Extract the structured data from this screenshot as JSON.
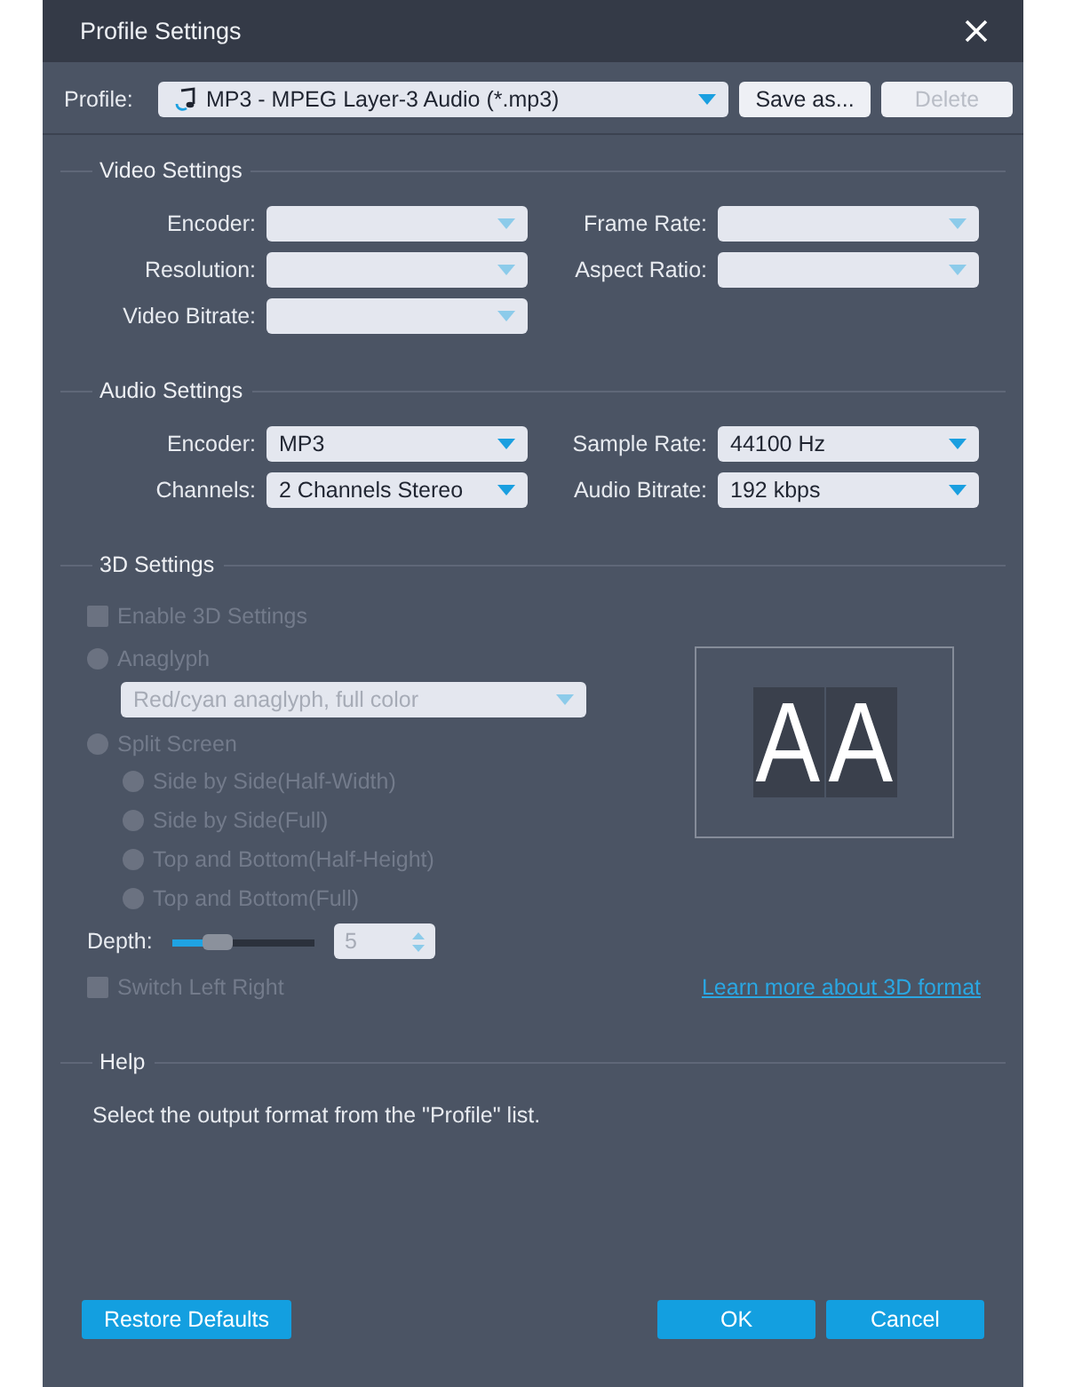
{
  "window": {
    "title": "Profile Settings"
  },
  "profile": {
    "label": "Profile:",
    "value": "MP3 - MPEG Layer-3 Audio (*.mp3)",
    "buttons": [
      {
        "label": "Save as...",
        "disabled": false
      },
      {
        "label": "Delete",
        "disabled": true
      }
    ]
  },
  "video_settings": {
    "title": "Video Settings",
    "fields": [
      {
        "label": "Encoder:",
        "disabled": true
      },
      {
        "label": "Frame Rate:",
        "disabled": true
      },
      {
        "label": "Resolution:",
        "disabled": true
      },
      {
        "label": "Aspect Ratio:",
        "disabled": true
      },
      {
        "label": "Video Bitrate:",
        "disabled": true
      }
    ]
  },
  "audio_settings": {
    "title": "Audio Settings",
    "fields": [
      {
        "label": "Encoder:",
        "value": "MP3",
        "disabled": false
      },
      {
        "label": "Sample Rate:",
        "value": "44100 Hz",
        "disabled": false
      },
      {
        "label": "Channels:",
        "value": "2 Channels Stereo",
        "disabled": false
      },
      {
        "label": "Audio Bitrate:",
        "value": "192 kbps",
        "disabled": false
      }
    ]
  },
  "three_d": {
    "title": "3D Settings",
    "enable": {
      "label": "Enable 3D Settings",
      "checked": false,
      "disabled": true
    },
    "modes": [
      {
        "label": "Anaglyph",
        "selected": false,
        "disabled": true,
        "dropdown": {
          "value": "Red/cyan anaglyph, full color",
          "disabled": true
        }
      },
      {
        "label": "Split Screen",
        "selected": false,
        "disabled": true,
        "options": [
          {
            "label": "Side by Side(Half-Width)",
            "selected": false,
            "disabled": true
          },
          {
            "label": "Side by Side(Full)",
            "selected": false,
            "disabled": true
          },
          {
            "label": "Top and Bottom(Half-Height)",
            "selected": false,
            "disabled": true
          },
          {
            "label": "Top and Bottom(Full)",
            "selected": false,
            "disabled": true
          }
        ]
      }
    ],
    "depth": {
      "label": "Depth:",
      "level": 0.27,
      "value": "5",
      "disabled": true
    },
    "switch": {
      "label": "Switch Left Right",
      "checked": false,
      "disabled": true
    },
    "preview": {
      "letters": [
        "A",
        "A"
      ]
    },
    "link": "Learn more about 3D format"
  },
  "help": {
    "title": "Help",
    "text": "Select the output format from the \"Profile\" list."
  },
  "footer": {
    "left_buttons": [
      {
        "label": "Restore Defaults"
      }
    ],
    "right_buttons": [
      {
        "label": "OK"
      },
      {
        "label": "Cancel"
      }
    ]
  }
}
